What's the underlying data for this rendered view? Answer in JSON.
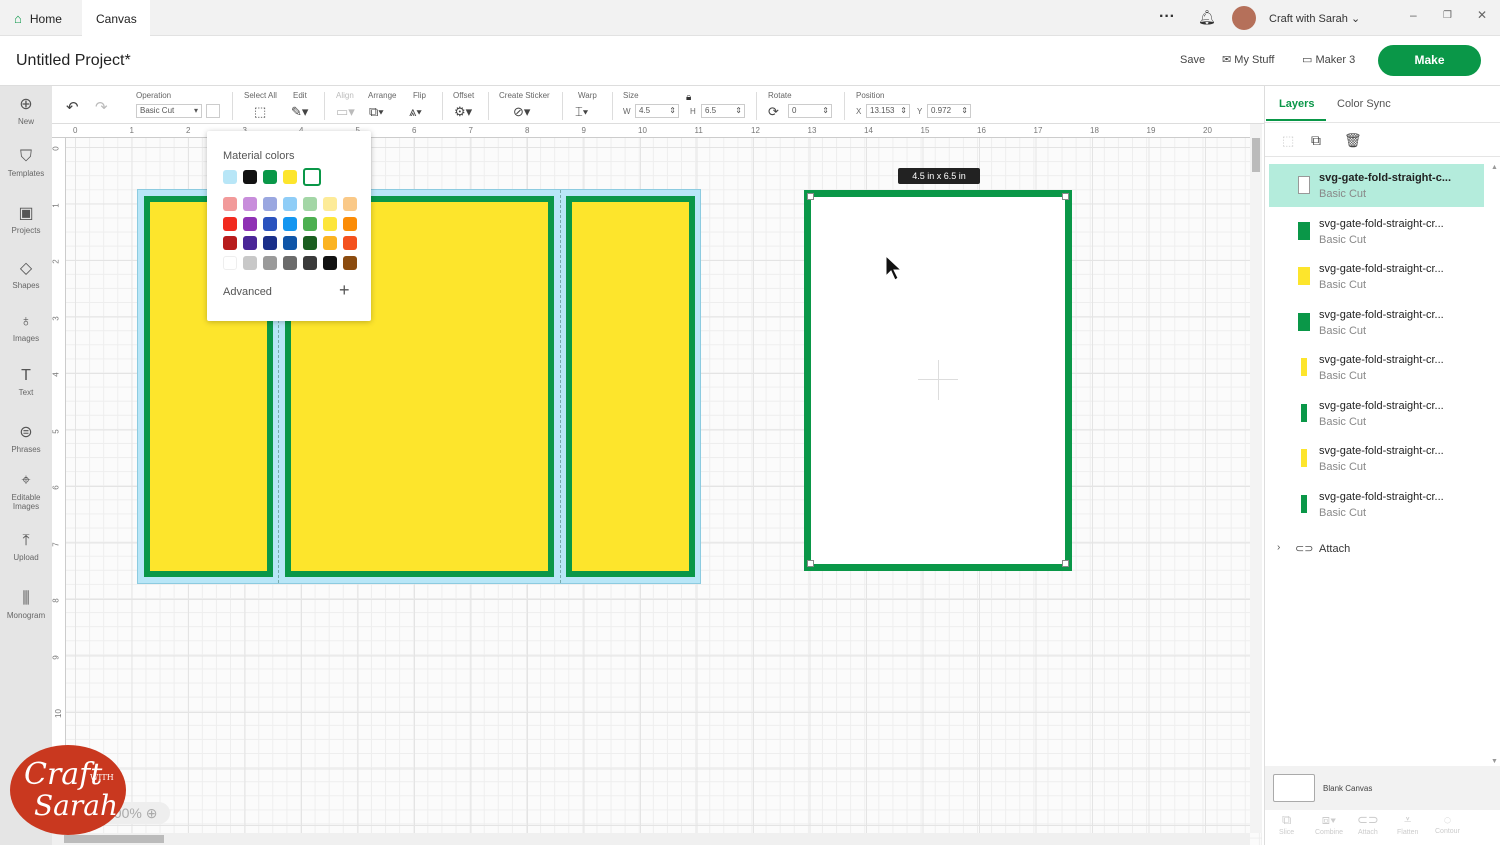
{
  "tabs": [
    {
      "label": "Home"
    },
    {
      "label": "Canvas"
    }
  ],
  "header": {
    "user": "Craft with Sarah",
    "project_title": "Untitled Project*",
    "save": "Save",
    "my_stuff": "My Stuff",
    "machine": "Maker 3",
    "make": "Make"
  },
  "toolbar": {
    "operation_label": "Operation",
    "operation_value": "Basic Cut",
    "select_all": "Select All",
    "edit": "Edit",
    "align": "Align",
    "arrange": "Arrange",
    "flip": "Flip",
    "offset": "Offset",
    "create_sticker": "Create Sticker",
    "warp": "Warp",
    "size": "Size",
    "w_label": "W",
    "w": "4.5",
    "h_label": "H",
    "h": "6.5",
    "rotate": "Rotate",
    "rotate_value": "0",
    "position": "Position",
    "x_label": "X",
    "x": "13.153",
    "y_label": "Y",
    "y": "0.972"
  },
  "sidebar": [
    {
      "label": "New",
      "icon": "plus-circle-icon",
      "glyph": "⊕"
    },
    {
      "label": "Templates",
      "icon": "shirt-icon",
      "glyph": "⛉"
    },
    {
      "label": "Projects",
      "icon": "projects-icon",
      "glyph": "▣"
    },
    {
      "label": "Shapes",
      "icon": "shapes-icon",
      "glyph": "◇"
    },
    {
      "label": "Images",
      "icon": "bulb-icon",
      "glyph": "♁"
    },
    {
      "label": "Text",
      "icon": "text-icon",
      "glyph": "T"
    },
    {
      "label": "Phrases",
      "icon": "phrases-icon",
      "glyph": "⊜"
    },
    {
      "label": "Editable Images",
      "icon": "editable-images-icon",
      "glyph": "⌖"
    },
    {
      "label": "Upload",
      "icon": "upload-icon",
      "glyph": "⤒"
    },
    {
      "label": "Monogram",
      "icon": "monogram-icon",
      "glyph": "⫼"
    }
  ],
  "ruler_h": [
    "0",
    "1",
    "2",
    "3",
    "4",
    "5",
    "6",
    "7",
    "8",
    "9",
    "10",
    "11",
    "12",
    "13",
    "14",
    "15",
    "16",
    "17",
    "18",
    "19",
    "20"
  ],
  "ruler_v": [
    "0",
    "1",
    "2",
    "3",
    "4",
    "5",
    "6",
    "7",
    "8",
    "9",
    "10"
  ],
  "size_label": "4.5  in x 6.5  in",
  "popup": {
    "title": "Material colors",
    "advanced": "Advanced",
    "material": [
      "#b8e6f7",
      "#111111",
      "#0a9748",
      "#fde52c",
      "#ffffff"
    ],
    "palette": [
      [
        "#f29a9a",
        "#c88ddb",
        "#9aa7e0",
        "#8fcdf7",
        "#a3d6a6",
        "#fdeb98",
        "#fac988"
      ],
      [
        "#f12a1f",
        "#8e30b4",
        "#2a52be",
        "#1496f0",
        "#4caf50",
        "#fde53a",
        "#fb8c06"
      ],
      [
        "#b71c1c",
        "#4a2597",
        "#1a2f8a",
        "#0f55a8",
        "#1b5e20",
        "#fbb321",
        "#f4511e"
      ],
      [
        "#ffffff",
        "#c8c8c8",
        "#9a9a9a",
        "#6b6b6b",
        "#3a3a3a",
        "#111111",
        "#8b4b0f"
      ]
    ]
  },
  "panel": {
    "tab_layers": "Layers",
    "tab_colorsync": "Color Sync",
    "layers": [
      {
        "name": "svg-gate-fold-straight-c...",
        "op": "Basic Cut",
        "color": "#ffffff",
        "selected": true,
        "thin": false
      },
      {
        "name": "svg-gate-fold-straight-cr...",
        "op": "Basic Cut",
        "color": "#0a9748",
        "thin": false
      },
      {
        "name": "svg-gate-fold-straight-cr...",
        "op": "Basic Cut",
        "color": "#fde52c",
        "thin": false
      },
      {
        "name": "svg-gate-fold-straight-cr...",
        "op": "Basic Cut",
        "color": "#0a9748",
        "thin": false
      },
      {
        "name": "svg-gate-fold-straight-cr...",
        "op": "Basic Cut",
        "color": "#fde52c",
        "thin": true
      },
      {
        "name": "svg-gate-fold-straight-cr...",
        "op": "Basic Cut",
        "color": "#0a9748",
        "thin": true
      },
      {
        "name": "svg-gate-fold-straight-cr...",
        "op": "Basic Cut",
        "color": "#fde52c",
        "thin": true
      },
      {
        "name": "svg-gate-fold-straight-cr...",
        "op": "Basic Cut",
        "color": "#0a9748",
        "thin": true
      }
    ],
    "group": "Attach",
    "blank_canvas": "Blank Canvas",
    "bottom": [
      "Slice",
      "Combine",
      "Attach",
      "Flatten",
      "Contour"
    ]
  },
  "zoom": "100%",
  "logo": {
    "text1": "Craft",
    "text2": "WITH",
    "text3": "Sarah",
    "color": "#c9381f"
  },
  "colors": {
    "accent": "#0a9748",
    "yellow": "#fde52c",
    "light_blue": "#b8e6f7",
    "selected_layer": "#b4ecdc"
  }
}
